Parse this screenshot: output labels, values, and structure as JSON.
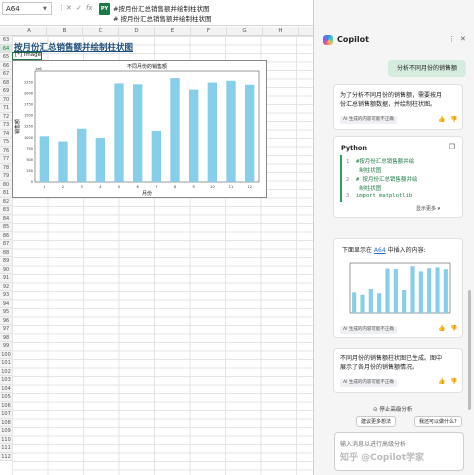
{
  "formula_bar": {
    "name_box": "A64",
    "python_badge": "PY",
    "line1": "#按月份汇总销售额并绘制柱状图",
    "line2": "# 按月份汇总销售额并绘制柱状图"
  },
  "grid": {
    "columns": [
      "A",
      "B",
      "C",
      "D",
      "E",
      "F",
      "G",
      "H"
    ],
    "rows": [
      "63",
      "64",
      "65",
      "66",
      "67",
      "68",
      "69",
      "70",
      "71",
      "72",
      "73",
      "74",
      "75",
      "76",
      "77",
      "78",
      "79",
      "80",
      "81",
      "82",
      "83",
      "84",
      "85",
      "86",
      "87",
      "88",
      "89",
      "90",
      "91",
      "92",
      "93",
      "94",
      "95",
      "96",
      "97",
      "98",
      "99",
      "100",
      "101",
      "102",
      "103",
      "104",
      "105",
      "106",
      "107",
      "108",
      "109",
      "110",
      "111",
      "112"
    ],
    "sheet_title": "按月份汇总销售额并绘制柱状图",
    "image_cell": "[*] Image"
  },
  "chart_data": [
    {
      "type": "bar",
      "title": "不同月份的销售额",
      "xlabel": "月份",
      "ylabel": "销售额",
      "categories": [
        "1",
        "2",
        "3",
        "4",
        "5",
        "6",
        "7",
        "8",
        "9",
        "10",
        "11",
        "12"
      ],
      "values": [
        1030,
        910,
        1200,
        990,
        2220,
        2200,
        1150,
        2340,
        2080,
        2240,
        2280,
        2190
      ],
      "ylim": [
        0,
        2500
      ],
      "y_ticks": [
        0,
        250,
        500,
        750,
        1000,
        1250,
        1500,
        1750,
        2000,
        2250
      ],
      "y_top_label": "1e6",
      "bar_color": "#87ceeb",
      "grid": false
    },
    {
      "type": "bar",
      "title": "",
      "categories": [
        "1",
        "2",
        "3",
        "4",
        "5",
        "6",
        "7",
        "8",
        "9",
        "10",
        "11",
        "12"
      ],
      "values": [
        1030,
        910,
        1200,
        990,
        2220,
        2200,
        1150,
        2340,
        2080,
        2240,
        2280,
        2190
      ],
      "ylim": [
        0,
        2500
      ],
      "bar_color": "#87ceeb"
    }
  ],
  "copilot": {
    "title": "Copilot",
    "user_message": "分析不同月份的销售额",
    "reply_1": [
      "为了分析不同月份的销售额，需要按月",
      "份汇总销售额数据，并绘制柱状图。"
    ],
    "ai_note": "AI 生成的内容可能不正确",
    "code_label": "Python",
    "code_lines": [
      {
        "num": "1",
        "text": "#按月份汇总销售额并绘"
      },
      {
        "num": "",
        "text": "制柱状图"
      },
      {
        "num": "2",
        "text": "# 按月份汇总销售额并绘"
      },
      {
        "num": "",
        "text": "制柱状图"
      },
      {
        "num": "3",
        "text": "import matplotlib"
      }
    ],
    "show_more": "显示更多 ▾",
    "preview_prefix": "下面显示在 ",
    "preview_link": "A64",
    "preview_suffix": " 中插入的内容:",
    "result_text": [
      "不同月份的销售额柱状图已生成。图中",
      "展示了各月份的销售额情况。"
    ],
    "stop_label": "⊙ 停止高级分析",
    "chip_1": "建议更多想法",
    "chip_2": "我还可以做什么?",
    "input_placeholder": "输入消息以进行高级分析",
    "watermark": "知乎 @Copilot学家"
  },
  "colors": {
    "excel_green": "#1e7a44",
    "bar_blue": "#87ceeb",
    "user_bubble": "#d5ecde",
    "link_blue": "#2a6fc9"
  },
  "icons": [
    "chevron-down-icon",
    "more-icon",
    "close-icon",
    "check-icon",
    "function-icon",
    "copilot-logo-icon",
    "copy-icon",
    "thumbs-up-icon",
    "thumbs-down-icon",
    "stop-icon"
  ]
}
